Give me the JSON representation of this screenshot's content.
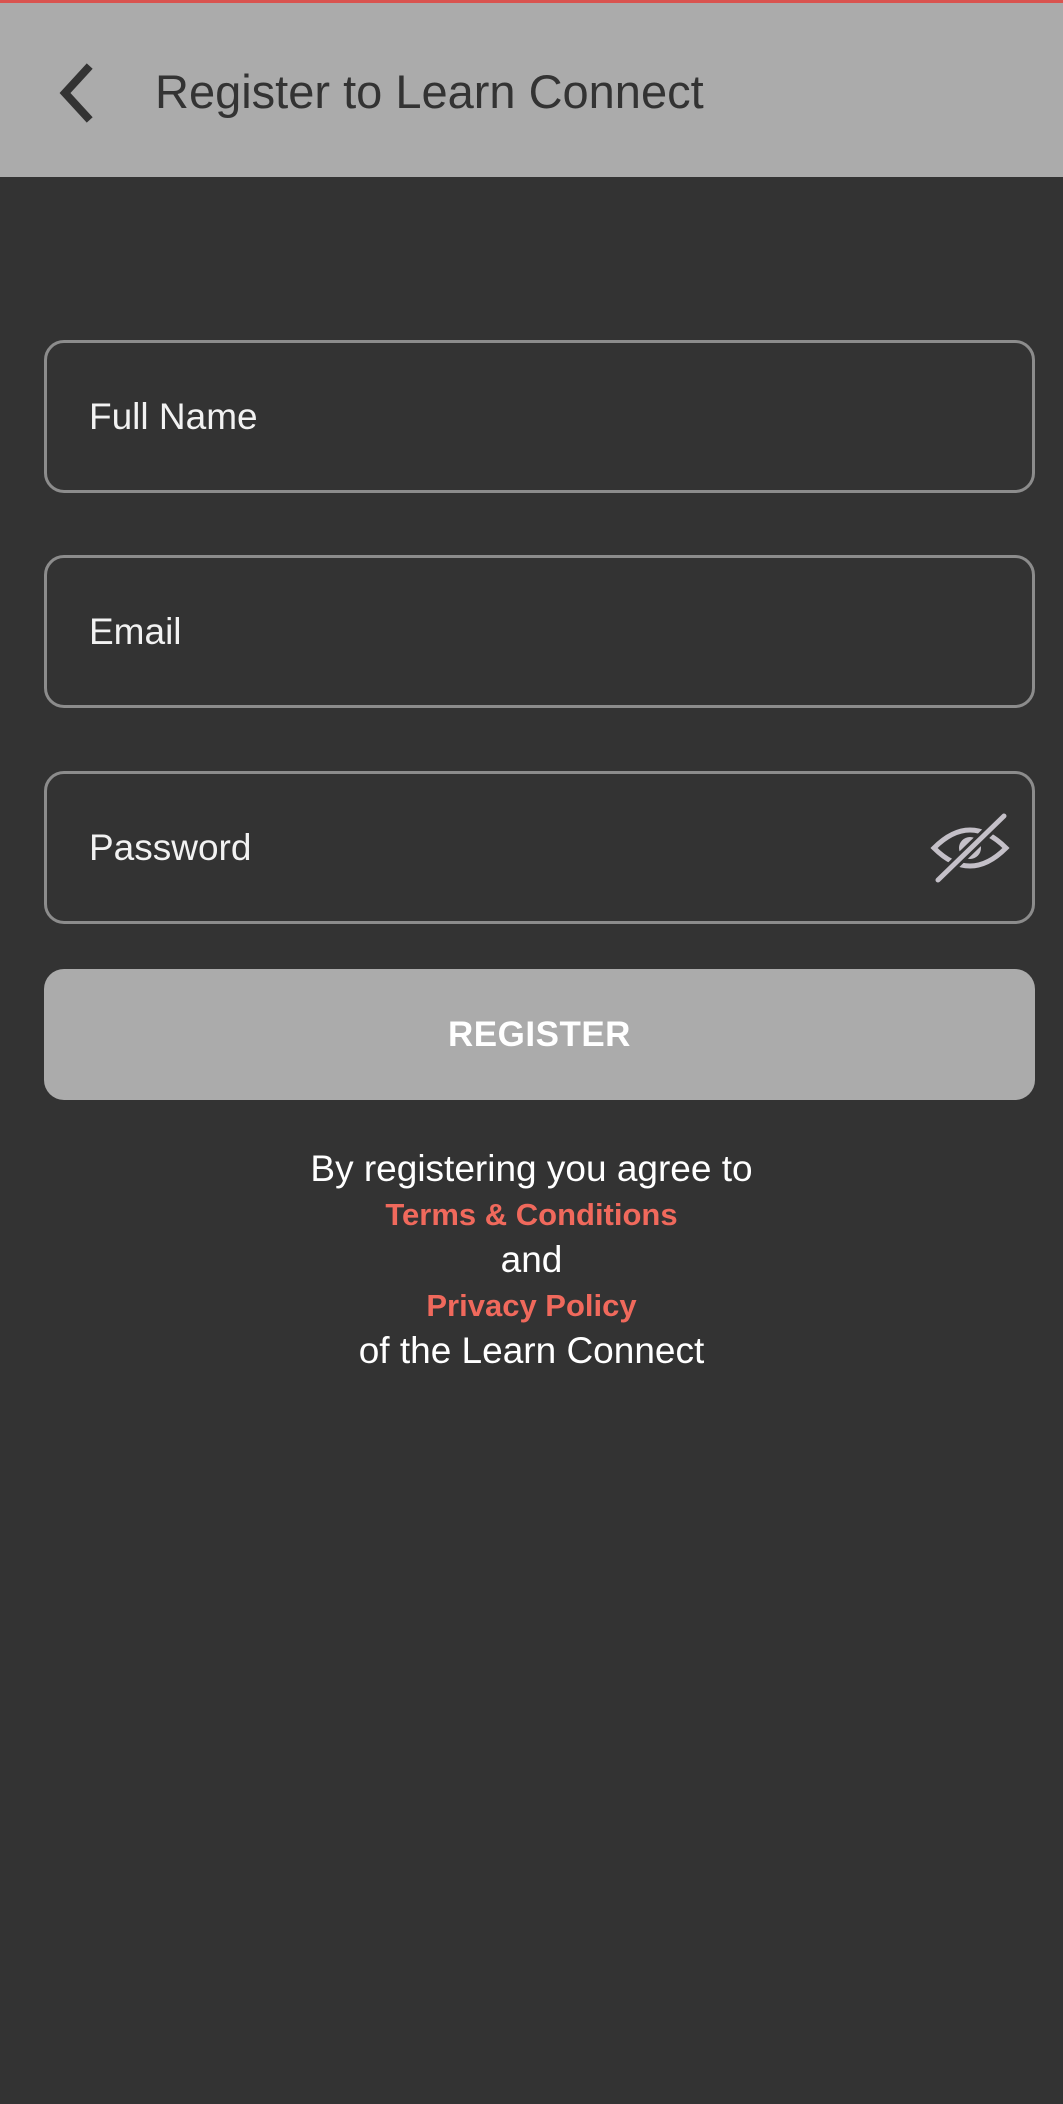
{
  "header": {
    "title": "Register to Learn Connect",
    "back_icon": "chevron-left-icon"
  },
  "form": {
    "full_name": {
      "value": "",
      "placeholder": "Full Name"
    },
    "email": {
      "value": "",
      "placeholder": "Email"
    },
    "password": {
      "value": "",
      "placeholder": "Password",
      "toggle_icon": "eye-slash-icon"
    },
    "register_label": "REGISTER"
  },
  "agreement": {
    "line1": "By registering you agree to",
    "terms_link": "Terms & Conditions",
    "and_text": "and",
    "privacy_link": "Privacy Policy",
    "line_last": "of the Learn Connect"
  },
  "colors": {
    "background": "#333333",
    "app_bar": "#ababab",
    "link": "#f0695c",
    "button": "#ababab"
  }
}
